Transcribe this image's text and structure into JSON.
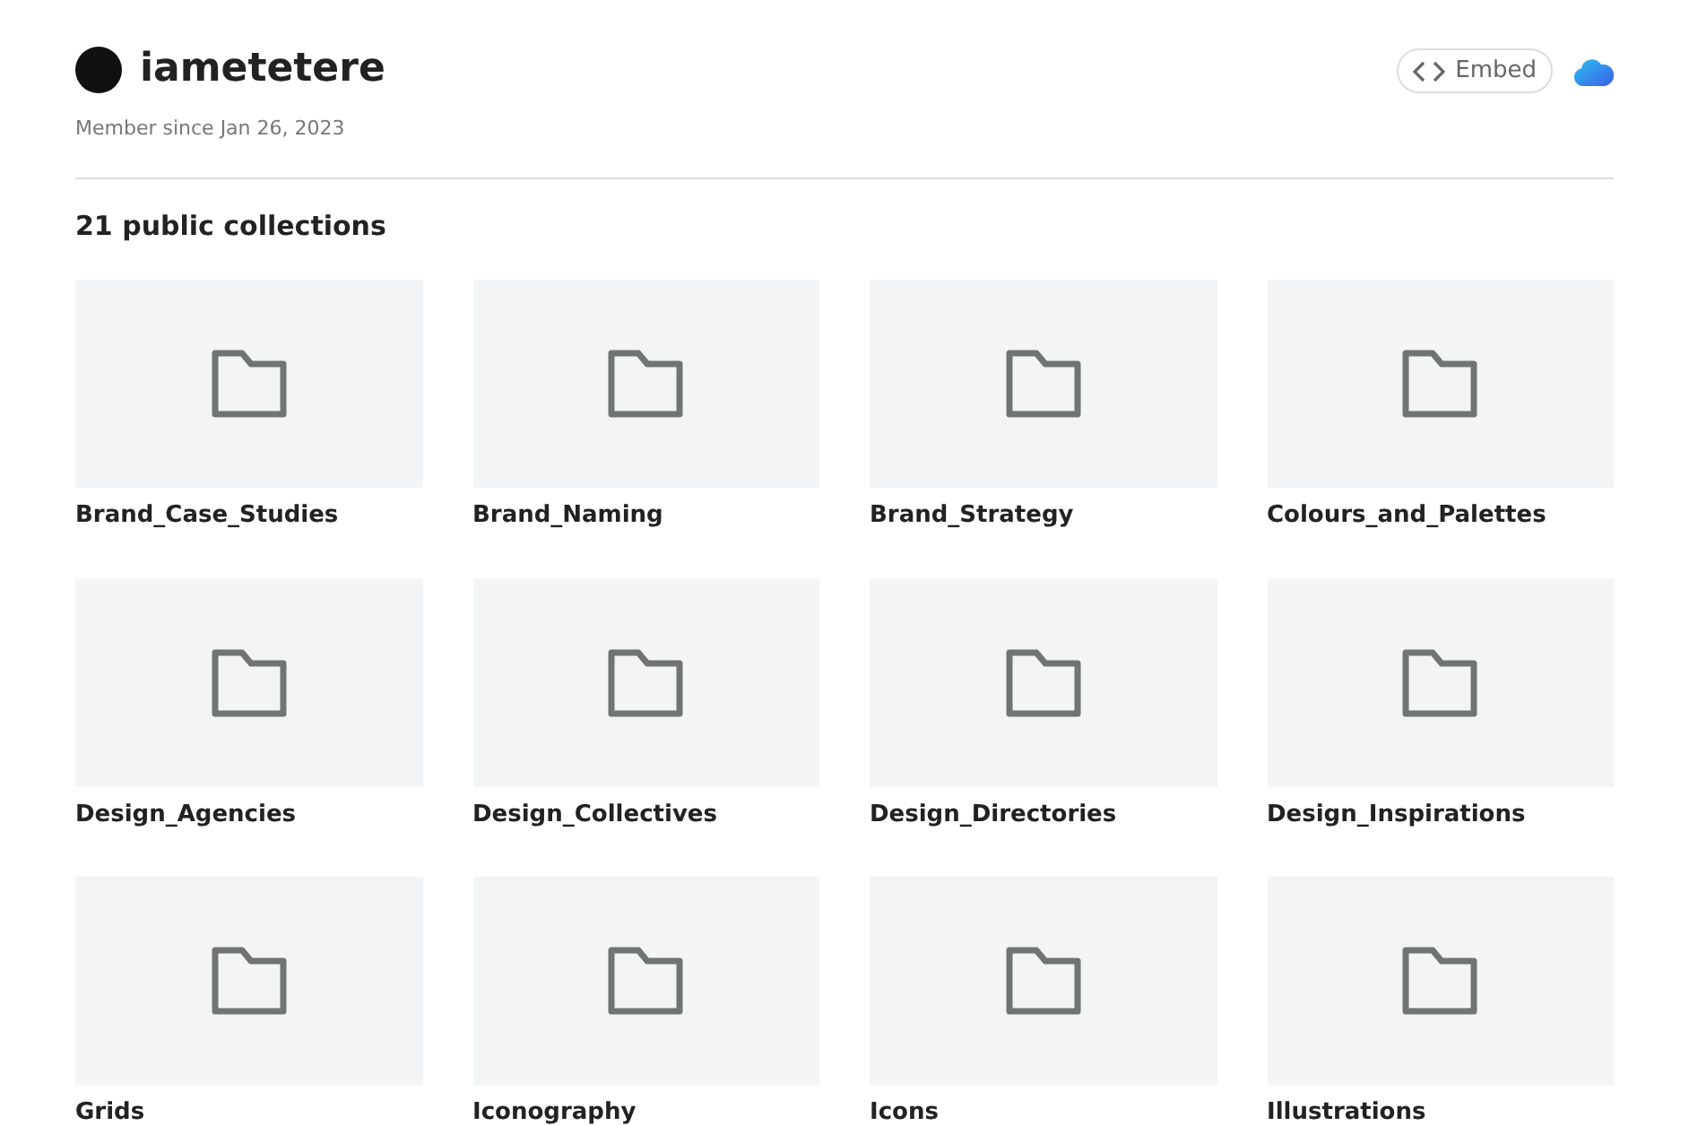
{
  "profile": {
    "username": "iametetere",
    "member_since": "Member since Jan 26, 2023"
  },
  "embed_button": {
    "label": "Embed"
  },
  "collections_heading": "21 public collections",
  "collections": [
    {
      "name": "Brand_Case_Studies"
    },
    {
      "name": "Brand_Naming"
    },
    {
      "name": "Brand_Strategy"
    },
    {
      "name": "Colours_and_Palettes"
    },
    {
      "name": "Design_Agencies"
    },
    {
      "name": "Design_Collectives"
    },
    {
      "name": "Design_Directories"
    },
    {
      "name": "Design_Inspirations"
    },
    {
      "name": "Grids"
    },
    {
      "name": "Iconography"
    },
    {
      "name": "Icons"
    },
    {
      "name": "Illustrations"
    }
  ]
}
